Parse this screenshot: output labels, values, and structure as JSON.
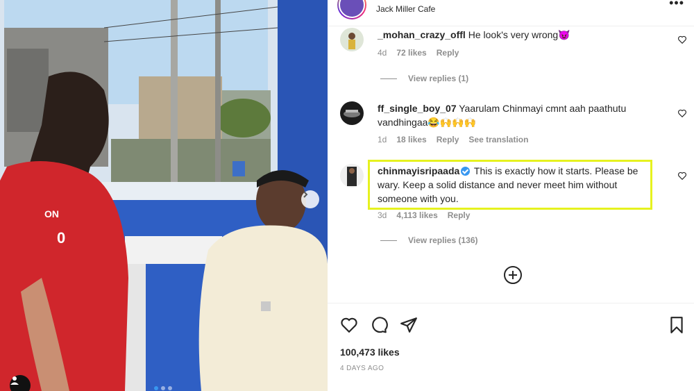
{
  "header": {
    "location": "Jack Miller Cafe",
    "more": "•••"
  },
  "photo": {
    "shirt_text_1": "ON",
    "shirt_text_2": "0"
  },
  "comments": [
    {
      "username": "_mohan_crazy_offl",
      "text": "He look's very wrong😈",
      "age": "4d",
      "likes": "72 likes",
      "reply": "Reply",
      "view_replies": "View replies (1)"
    },
    {
      "username": "ff_single_boy_07",
      "text": "Yaarulam Chinmayi cmnt aah paathutu vandhingaa😂🙌🙌🙌",
      "age": "1d",
      "likes": "18 likes",
      "reply": "Reply",
      "translation": "See translation"
    },
    {
      "username": "chinmayisripaada",
      "text": "This is exactly how it starts. Please be wary. Keep a solid distance and never meet him without someone with you.",
      "age": "3d",
      "likes": "4,113 likes",
      "reply": "Reply",
      "view_replies": "View replies (136)",
      "verified": true
    }
  ],
  "footer": {
    "likes": "100,473 likes",
    "date": "4 DAYS AGO"
  },
  "colors": {
    "highlight": "#e6f21f",
    "verified": "#3897f0",
    "muted": "#8e8e8e"
  }
}
